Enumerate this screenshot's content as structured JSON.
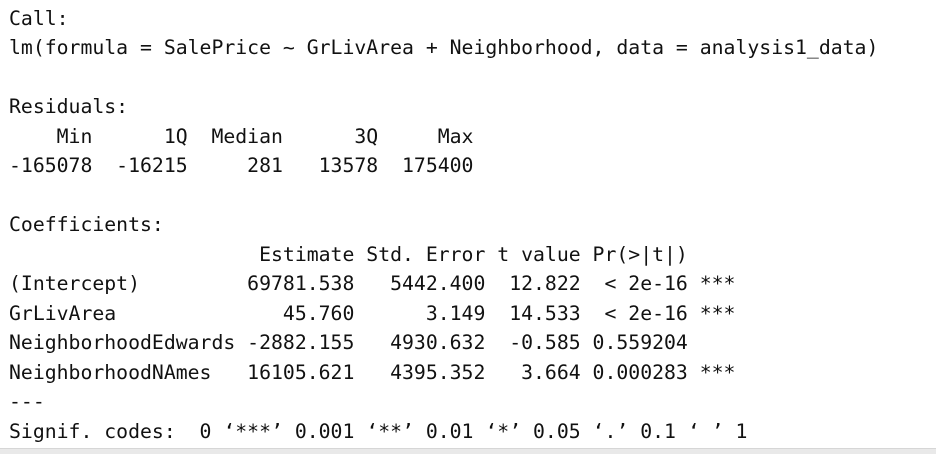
{
  "console": {
    "lines": [
      "Call:",
      "lm(formula = SalePrice ~ GrLivArea + Neighborhood, data = analysis1_data)",
      "",
      "Residuals:",
      "    Min      1Q  Median      3Q     Max ",
      "-165078  -16215     281   13578  175400 ",
      "",
      "Coefficients:",
      "                     Estimate Std. Error t value Pr(>|t|)    ",
      "(Intercept)         69781.538   5442.400  12.822  < 2e-16 ***",
      "GrLivArea              45.760      3.149  14.533  < 2e-16 ***",
      "NeighborhoodEdwards -2882.155   4930.632  -0.585 0.559204    ",
      "NeighborhoodNAmes   16105.621   4395.352   3.664 0.000283 ***",
      "---",
      "Signif. codes:  0 ‘***’ 0.001 ‘**’ 0.01 ‘*’ 0.05 ‘.’ 0.1 ‘ ’ 1"
    ]
  }
}
